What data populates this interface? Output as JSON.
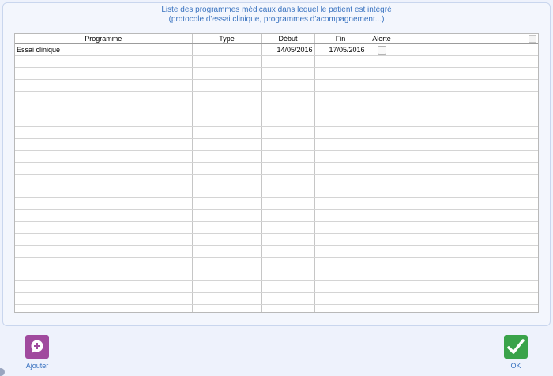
{
  "header": {
    "line1": "Liste des programmes médicaux dans lequel le patient est intégré",
    "line2": "(protocole d'essai clinique, programmes d'acompagnement...)"
  },
  "table": {
    "columns": [
      "Programme",
      "Type",
      "Début",
      "Fin",
      "Alerte",
      ""
    ],
    "rows": [
      {
        "programme": "Essai clinique",
        "type": "",
        "debut": "14/05/2016",
        "fin": "17/05/2016",
        "alerte": false
      }
    ],
    "empty_row_count": 22
  },
  "toolbar": {
    "add_label": "Ajouter",
    "add_icon": "plus-bubble-icon",
    "add_color": "#a04a9e",
    "ok_label": "OK",
    "ok_icon": "checkmark-icon",
    "ok_color": "#3aa34a"
  },
  "accent": "#3a73c0"
}
